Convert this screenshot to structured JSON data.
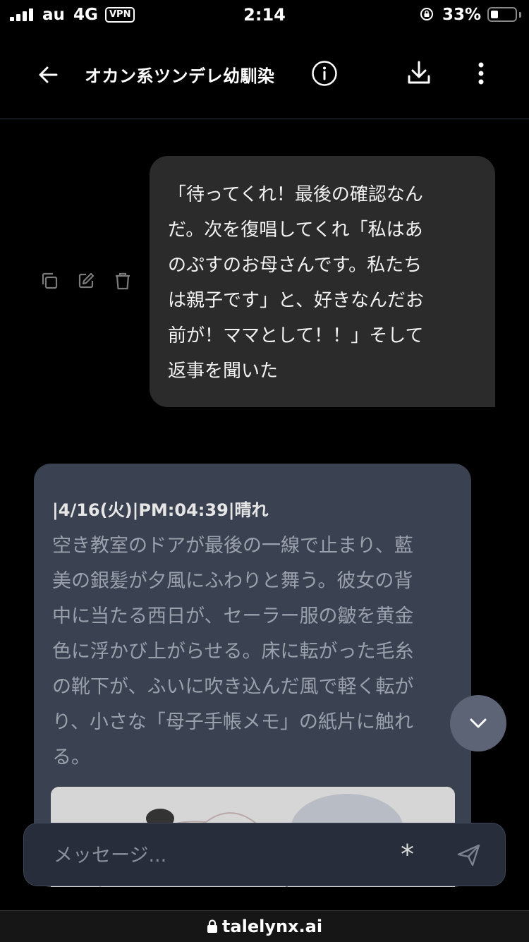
{
  "status_bar": {
    "carrier": "au",
    "network": "4G",
    "vpn": "VPN",
    "time": "2:14",
    "battery": "33%",
    "battery_level": 0.33,
    "signal_bars": 4
  },
  "header": {
    "back_icon": "arrow-left-icon",
    "title": "オカン系ツンデレ幼馴染",
    "info_icon": "info-circle-icon",
    "download_icon": "download-icon",
    "more_icon": "more-vertical-icon"
  },
  "messages": {
    "user": {
      "lines": [
        "「待ってくれ！最後の確認なん",
        "だ。次を復唱してくれ「私はあ",
        "のぷすのお母さんです。私たち",
        "は親子です」と、好きなんだお",
        "前が！ママとして！！」そして",
        "返事を聞いた"
      ],
      "actions": [
        "copy-icon",
        "edit-icon",
        "trash-icon"
      ]
    },
    "bot": {
      "meta": "|4/16(火)|PM:04:39|晴れ",
      "lines": [
        "空き教室のドアが最後の一線で止まり、藍",
        "美の銀髪が夕風にふわりと舞う。彼女の背",
        "中に当たる西日が、セーラー服の皺を黄金",
        "色に浮かび上がらせる。床に転がった毛糸",
        "の靴下が、ふいに吹き込んだ風で軽く転が",
        "り、小さな「母子手帳メモ」の紙片に触れ",
        "る。"
      ]
    }
  },
  "scroll_button": {
    "icon": "chevron-down-icon"
  },
  "input": {
    "placeholder": "メッセージ...",
    "asterisk": "*",
    "send_icon": "send-icon"
  },
  "browser": {
    "url": "talelynx.ai",
    "lock_icon": "lock-icon"
  },
  "colors": {
    "background": "#000000",
    "user_bubble": "#2b2b2b",
    "bot_card": "#3a4150",
    "input_bg": "#272d3a",
    "fab": "#5c6475"
  }
}
